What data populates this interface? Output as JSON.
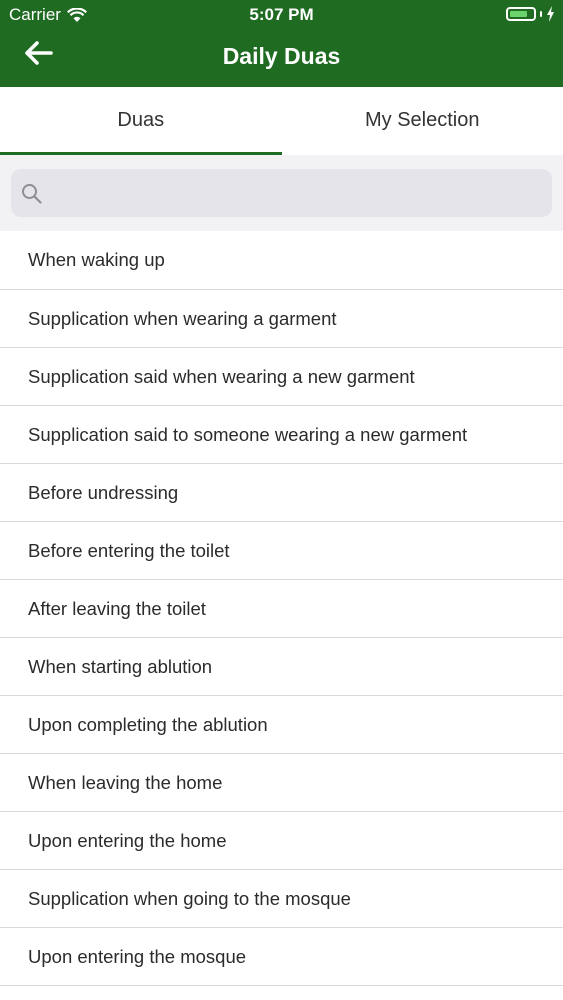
{
  "status_bar": {
    "carrier": "Carrier",
    "time": "5:07 PM",
    "battery_level": 0.75
  },
  "header": {
    "title": "Daily Duas",
    "back_icon": "arrow-left-icon",
    "color": "#1f6b22"
  },
  "tabs": [
    {
      "label": "Duas",
      "active": true
    },
    {
      "label": "My Selection",
      "active": false
    }
  ],
  "search": {
    "value": "",
    "placeholder": "",
    "icon": "search-icon"
  },
  "duas": [
    "When waking up",
    "Supplication when wearing a garment",
    "Supplication said when wearing a new garment",
    "Supplication said to someone wearing a new garment",
    "Before undressing",
    "Before entering the toilet",
    "After leaving the toilet",
    "When starting ablution",
    "Upon completing the ablution",
    "When leaving the home",
    "Upon entering the home",
    "Supplication when going to the mosque",
    "Upon entering the mosque"
  ]
}
